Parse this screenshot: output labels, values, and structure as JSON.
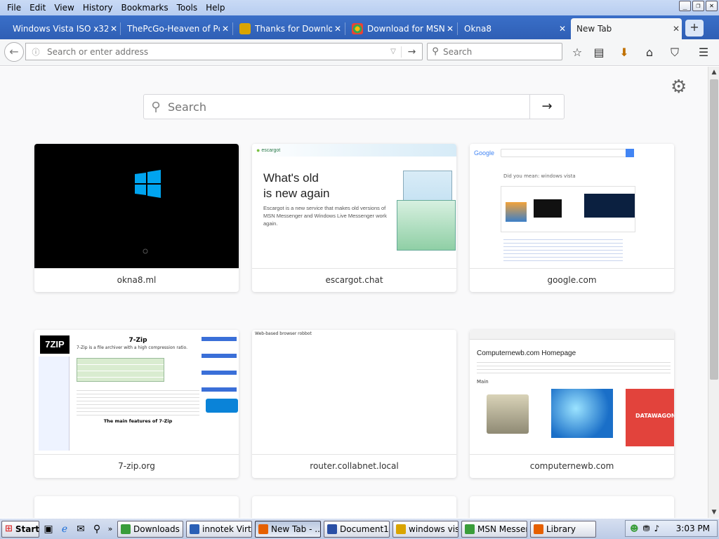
{
  "menu": [
    "File",
    "Edit",
    "View",
    "History",
    "Bookmarks",
    "Tools",
    "Help"
  ],
  "window_controls": {
    "minimize": "_",
    "maximize": "❐",
    "close": "✕"
  },
  "tabs": [
    {
      "label": "Windows Vista ISO x32...",
      "icon_color": "#2a7ae2",
      "active": false
    },
    {
      "label": "ThePcGo-Heaven of Pc ...",
      "icon_color": "#3a6fc8",
      "active": false
    },
    {
      "label": "Thanks for Downlo...",
      "icon_color": "#d9a400",
      "active": false
    },
    {
      "label": "Download for MSN ...",
      "icon_color": "#4caf50",
      "active": false
    },
    {
      "label": "Okna8",
      "icon_color": "#3a6fc8",
      "active": false
    },
    {
      "label": "New Tab",
      "icon_color": "#f5f6f7",
      "active": true
    }
  ],
  "tab_close": "✕",
  "new_tab": "+",
  "navbar": {
    "back": "←",
    "url_value": "",
    "url_placeholder": "Search or enter address",
    "go": "→",
    "search_placeholder": "Search"
  },
  "page": {
    "search_placeholder": "Search",
    "search_go": "→",
    "tiles": [
      {
        "label": "okna8.ml"
      },
      {
        "label": "escargot.chat",
        "headline_1": "What's old",
        "headline_2": "is new again",
        "logo": "escargot",
        "body": "Escargot is a new service that makes old versions of MSN Messenger and Windows Live Messenger work again."
      },
      {
        "label": "google.com",
        "logo": "Google",
        "query_hint": "Did you mean: windows vista"
      },
      {
        "label": "7-zip.org",
        "logo": "7ZIP",
        "title": "7-Zip",
        "subtitle": "7-Zip is a file archiver with a high compression ratio.",
        "section": "The main features of 7-Zip"
      },
      {
        "label": "router.collabnet.local",
        "text": "Web-based browser  robbot"
      },
      {
        "label": "computernewb.com",
        "heading": "Computernewb.com Homepage",
        "sub": "Main",
        "brand": "DATAWAGON"
      }
    ]
  },
  "taskbar": {
    "start": "Start",
    "items": [
      {
        "label": "Downloads",
        "color": "#3a9d3a",
        "active": false
      },
      {
        "label": "innotek Virtu...",
        "color": "#2a5fb5",
        "active": false
      },
      {
        "label": "New Tab - ...",
        "color": "#e66000",
        "active": true
      },
      {
        "label": "Document1 ...",
        "color": "#2a4fa5",
        "active": false
      },
      {
        "label": "windows vis...",
        "color": "#d9a400",
        "active": false
      },
      {
        "label": "MSN Messen...",
        "color": "#3a9d3a",
        "active": false
      },
      {
        "label": "Library",
        "color": "#e66000",
        "active": false
      }
    ],
    "clock": "3:03 PM"
  }
}
